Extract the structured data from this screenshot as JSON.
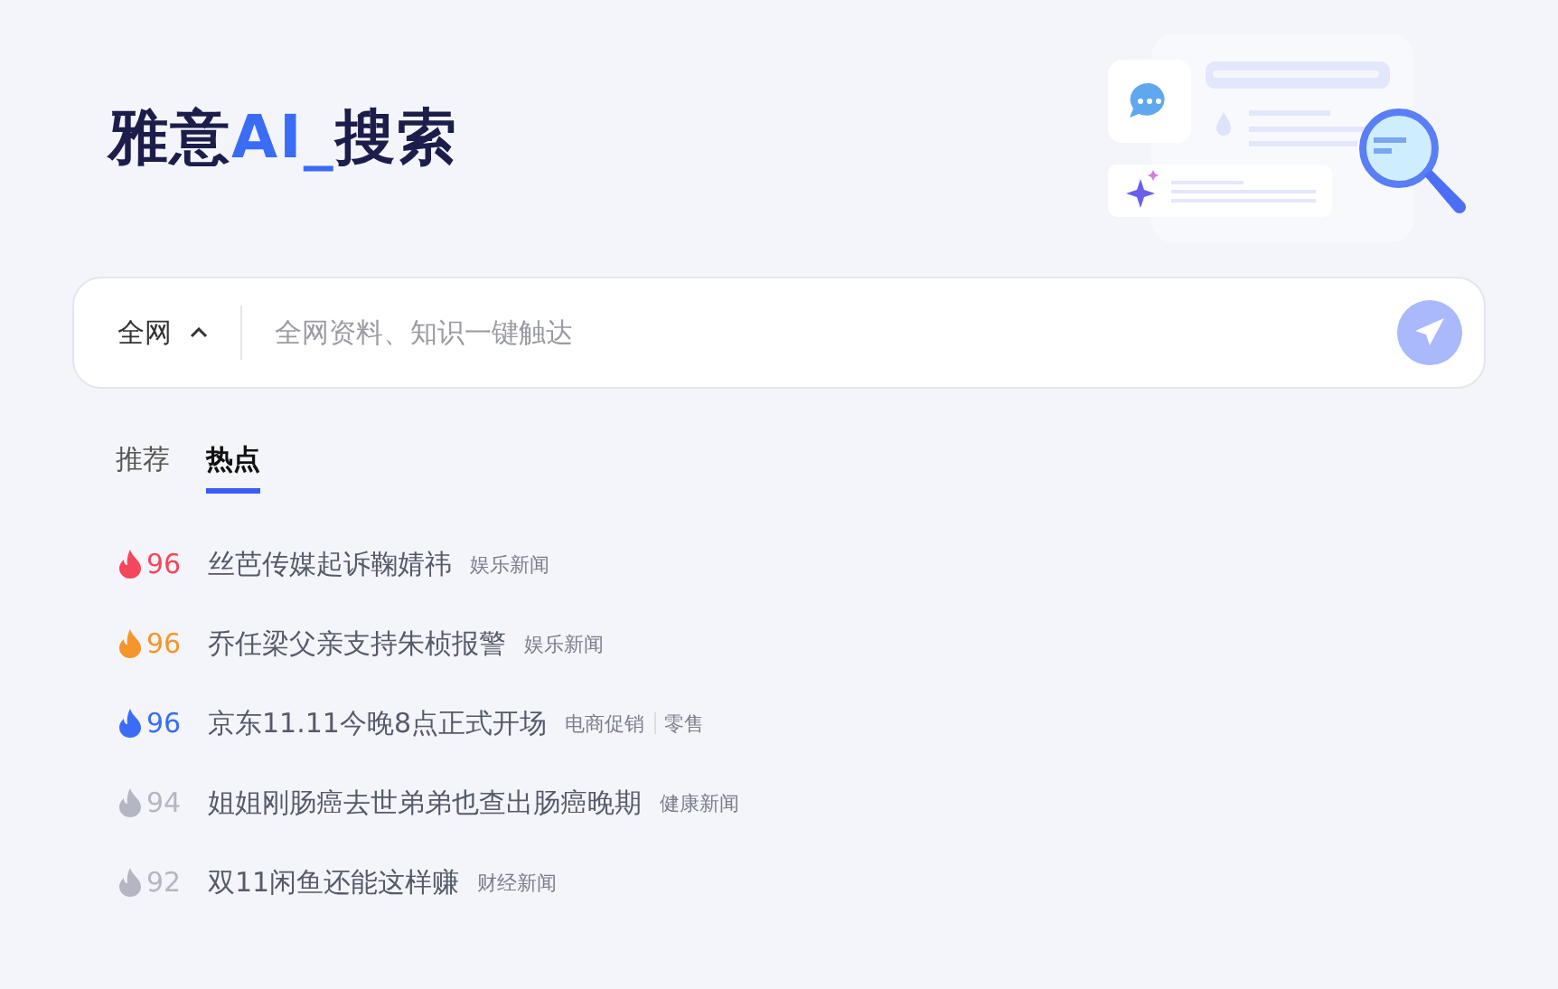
{
  "title_parts": [
    {
      "text": "雅意",
      "accent": false
    },
    {
      "text": "AI_",
      "accent": true
    },
    {
      "text": "搜索",
      "accent": false
    }
  ],
  "search": {
    "scope": "全网",
    "scope_expanded": true,
    "placeholder": "全网资料、知识一键触达"
  },
  "tabs": [
    {
      "label": "推荐",
      "selected": false
    },
    {
      "label": "热点",
      "selected": true
    }
  ],
  "hot_items": [
    {
      "score": "96",
      "color": "#f5475c",
      "title": "丝芭传媒起诉鞠婧祎",
      "tags": [
        "娱乐新闻"
      ]
    },
    {
      "score": "96",
      "color": "#f5952a",
      "title": "乔任梁父亲支持朱桢报警",
      "tags": [
        "娱乐新闻"
      ]
    },
    {
      "score": "96",
      "color": "#3a6cf5",
      "title": "京东11.11今晚8点正式开场",
      "tags": [
        "电商促销",
        "零售"
      ]
    },
    {
      "score": "94",
      "color": "#b4b6c2",
      "title": "姐姐刚肠癌去世弟弟也查出肠癌晚期",
      "tags": [
        "健康新闻"
      ]
    },
    {
      "score": "92",
      "color": "#b4b6c2",
      "title": "双11闲鱼还能这样赚",
      "tags": [
        "财经新闻"
      ]
    }
  ]
}
